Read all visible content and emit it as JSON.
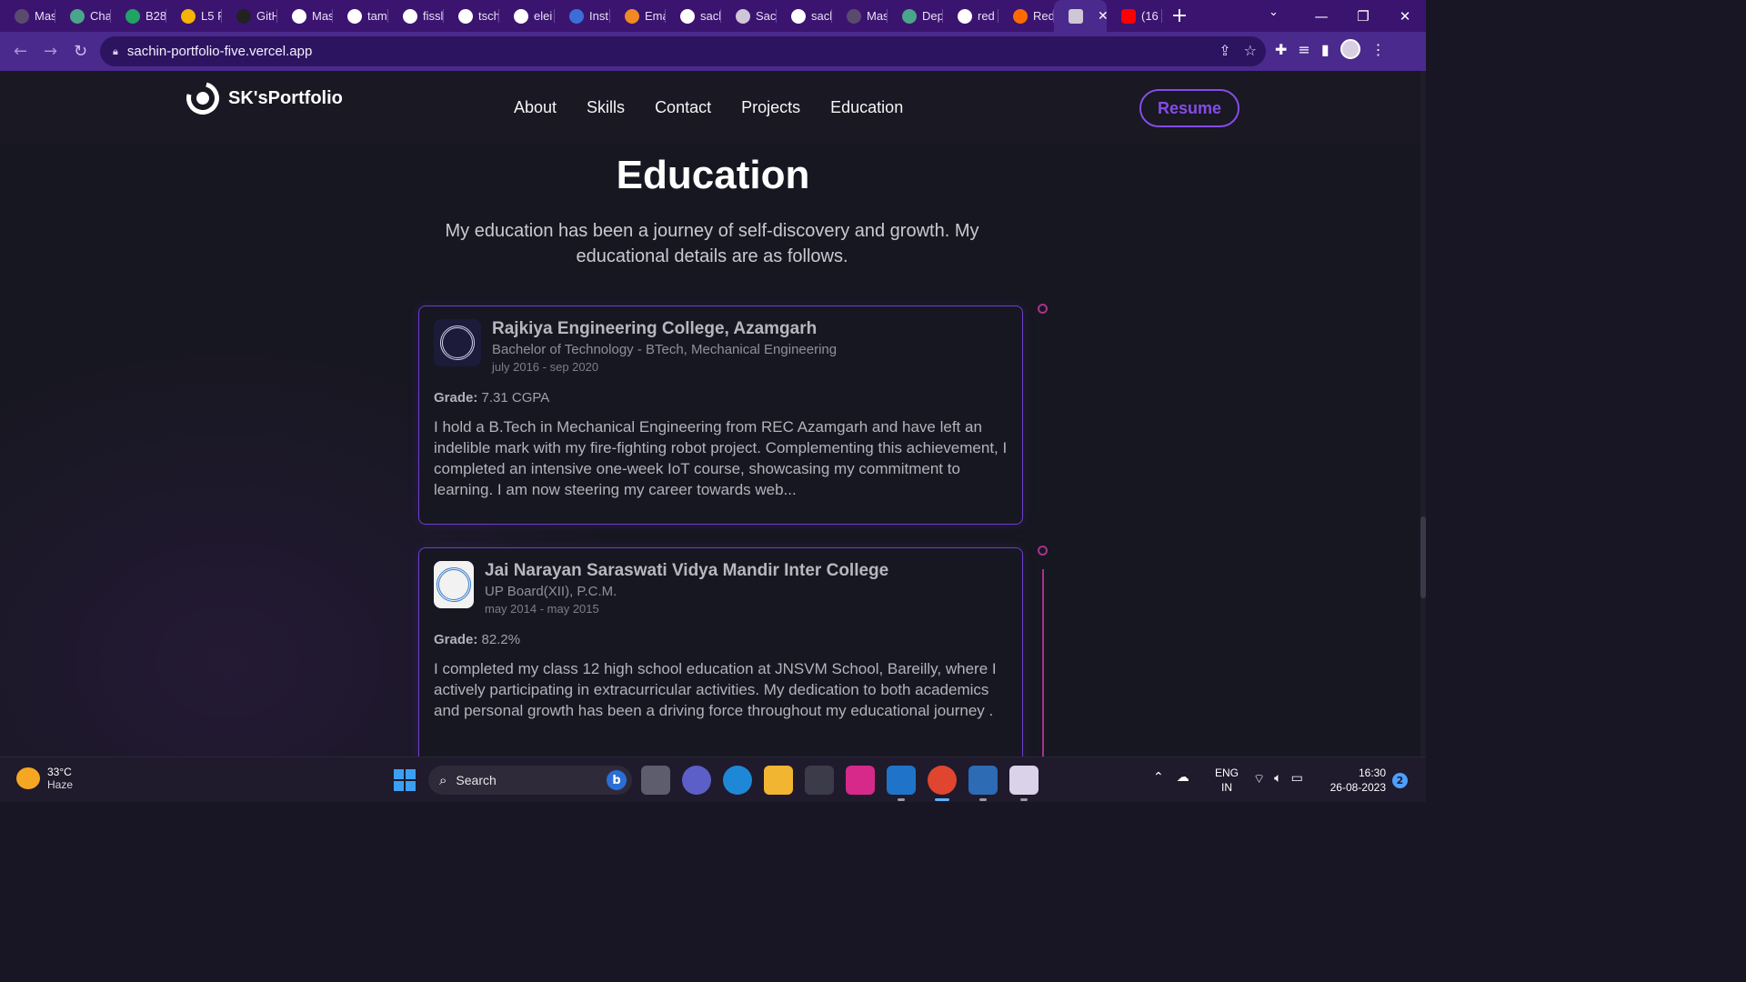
{
  "browser": {
    "tabs": [
      {
        "title": "Mas",
        "icon": "globe-icon",
        "color": "#5a4a6e"
      },
      {
        "title": "Cha",
        "icon": "chatgpt-icon",
        "color": "#4aa58a"
      },
      {
        "title": "B28",
        "icon": "sheets-icon",
        "color": "#1fa463"
      },
      {
        "title": "L5 F",
        "icon": "slides-icon",
        "color": "#f4b400"
      },
      {
        "title": "GitH",
        "icon": "github-icon",
        "color": "#222222"
      },
      {
        "title": "Mas",
        "icon": "medium-icon",
        "color": "#ffffff"
      },
      {
        "title": "tam",
        "icon": "github-icon",
        "color": "#ffffff"
      },
      {
        "title": "fissl",
        "icon": "github-icon",
        "color": "#ffffff"
      },
      {
        "title": "tsch",
        "icon": "github-icon",
        "color": "#ffffff"
      },
      {
        "title": "elei",
        "icon": "github-icon",
        "color": "#ffffff"
      },
      {
        "title": "Inst",
        "icon": "instagram-icon",
        "color": "#3a6fd8"
      },
      {
        "title": "Ema",
        "icon": "email-icon",
        "color": "#f08a24"
      },
      {
        "title": "sacl",
        "icon": "github-icon",
        "color": "#ffffff"
      },
      {
        "title": "Sacl",
        "icon": "profile-icon",
        "color": "#cfc6d6"
      },
      {
        "title": "sacl",
        "icon": "github-icon",
        "color": "#ffffff"
      },
      {
        "title": "Mas",
        "icon": "globe-icon",
        "color": "#5a4a6e"
      },
      {
        "title": "Dep",
        "icon": "chatgpt-icon",
        "color": "#4aa58a"
      },
      {
        "title": "red",
        "icon": "google-icon",
        "color": "#ffffff"
      },
      {
        "title": "Red",
        "icon": "mi-icon",
        "color": "#ff6a00"
      }
    ],
    "active_tab_icon": "profile-icon",
    "last_tab": {
      "title": "(16",
      "icon": "youtube-icon",
      "color": "#ff0000"
    },
    "new_tab": "+",
    "url": "sachin-portfolio-five.vercel.app"
  },
  "site": {
    "logo_text": "SK'sPortfolio",
    "menu": [
      "About",
      "Skills",
      "Contact",
      "Projects",
      "Education"
    ],
    "resume_label": "Resume",
    "accent": "#854ce6"
  },
  "section": {
    "title": "Education",
    "description": "My education has been a journey of self-discovery and growth. My educational details are as follows."
  },
  "education": [
    {
      "school": "Rajkiya Engineering College, Azamgarh",
      "degree": "Bachelor of Technology - BTech, Mechanical Engineering",
      "date": "july 2016 - sep 2020",
      "grade_label": "Grade:",
      "grade": "7.31 CGPA",
      "description": "I hold a B.Tech in Mechanical Engineering from REC Azamgarh and have left an indelible mark with my fire-fighting robot project. Complementing this achievement, I completed an intensive one-week IoT course, showcasing my commitment to learning. I am now steering my career towards web...",
      "logo_bg": "#1d1b3a"
    },
    {
      "school": "Jai Narayan Saraswati Vidya Mandir Inter College",
      "degree": "UP Board(XII), P.C.M.",
      "date": "may 2014 - may 2015",
      "grade_label": "Grade:",
      "grade": "82.2%",
      "description": "I completed my class 12 high school education at JNSVM School, Bareilly, where I actively participating in extracurricular activities. My dedication to both academics and personal growth has been a driving force throughout my educational journey .",
      "logo_bg": "#f2f2f2"
    }
  ],
  "taskbar": {
    "weather_temp": "33°C",
    "weather_desc": "Haze",
    "search_label": "Search",
    "lang_1": "ENG",
    "lang_2": "IN",
    "time": "16:30",
    "date": "26-08-2023",
    "notifications": "2"
  }
}
